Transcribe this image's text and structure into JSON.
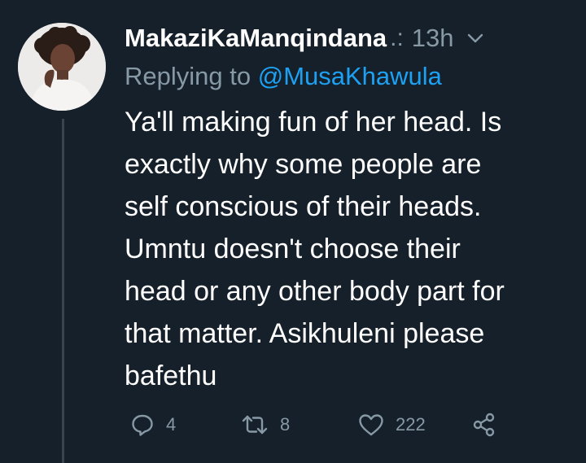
{
  "tweet": {
    "display_name": "MakaziKaManqindana",
    "more_glyph": ".:",
    "time": "13h",
    "reply_prefix": "Replying to ",
    "reply_mention": "@MusaKhawula",
    "lines": [
      "Ya'll making fun of her head. Is",
      "exactly why some people are",
      "self conscious of their heads.",
      "Umntu doesn't choose their",
      "head or any other body part for",
      "that matter. Asikhuleni please",
      "bafethu"
    ]
  },
  "actions": {
    "reply_count": "4",
    "retweet_count": "8",
    "like_count": "222"
  },
  "icons": {
    "reply": "reply-icon",
    "retweet": "retweet-icon",
    "like": "heart-icon",
    "share": "share-icon",
    "menu": "chevron-down-icon"
  },
  "colors": {
    "background": "#15202b",
    "text": "#ffffff",
    "muted": "#8899a6",
    "link": "#1da1f2",
    "thread_line": "#3a444c"
  }
}
